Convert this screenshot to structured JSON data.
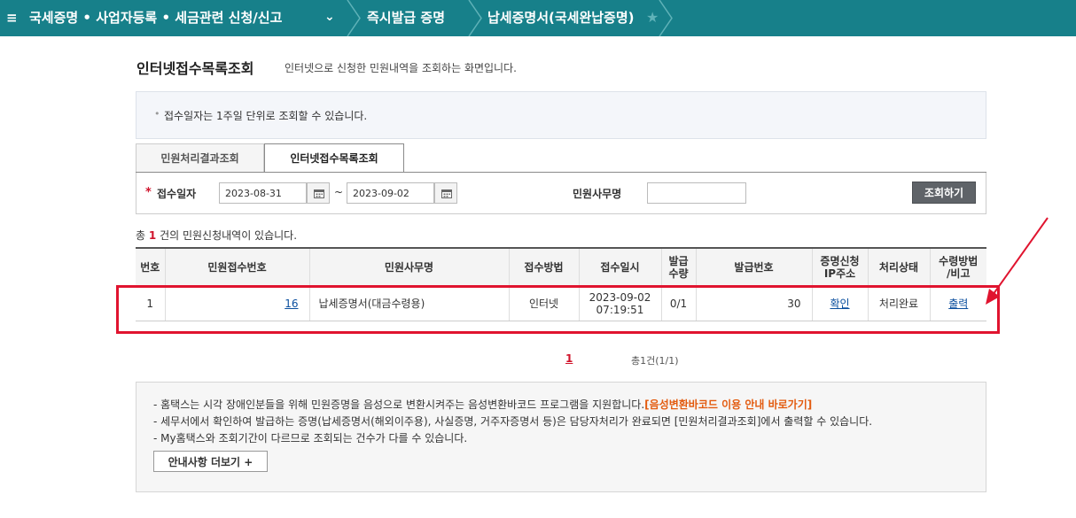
{
  "nav": {
    "menu_icon": "≡",
    "item1": "국세증명 • 사업자등록 • 세금관련 신청/신고",
    "item2": "즉시발급 증명",
    "item3": "납세증명서(국세완납증명)",
    "favorite_icon": "★"
  },
  "page": {
    "title": "인터넷접수목록조회",
    "description": "인터넷으로 신청한 민원내역을 조회하는 화면입니다."
  },
  "info": {
    "bullet": "•",
    "text": "접수일자는 1주일 단위로 조회할 수 있습니다."
  },
  "tabs": [
    {
      "label": "민원처리결과조회",
      "active": false
    },
    {
      "label": "인터넷접수목록조회",
      "active": true
    }
  ],
  "search": {
    "required_mark": "*",
    "date_label": "접수일자",
    "start_date": "2023-08-31",
    "tilde": "~",
    "end_date": "2023-09-02",
    "office_label": "민원사무명",
    "office_value": "",
    "button_label": "조회하기"
  },
  "count": {
    "prefix": "총",
    "number": "1",
    "suffix": "건의 민원신청내역이 있습니다."
  },
  "table": {
    "headers": [
      "번호",
      "민원접수번호",
      "민원사무명",
      "접수방법",
      "접수일시",
      "발급\n수량",
      "발급번호",
      "증명신청\nIP주소",
      "처리상태",
      "수령방법\n/비고"
    ],
    "rows": [
      {
        "no": "1",
        "receipt_no": "16",
        "office": "납세증명서(대금수령용)",
        "method": "인터넷",
        "date": "2023-09-02",
        "time": "07:19:51",
        "quantity": "0/1",
        "issue_no": "30",
        "ip": "확인",
        "status": "처리완료",
        "receive": "출력"
      }
    ]
  },
  "pagination": {
    "current": "1",
    "total": "총1건(1/1)"
  },
  "guide": {
    "line1": "- 홈택스는 시각 장애인분들을 위해 민원증명을 음성으로 변환시켜주는 음성변환바코드 프로그램을 지원합니다.",
    "line1_link": "[음성변환바코드 이용 안내 바로가기]",
    "line2": "- 세무서에서 확인하여 발급하는 증명(납세증명서(해외이주용), 사실증명, 거주자증명서 등)은 담당자처리가 완료되면 [민원처리결과조회]에서 출력할 수 있습니다.",
    "line3": "- My홈택스와 조회기간이 다르므로 조회되는 건수가 다를 수 있습니다.",
    "more_button": "안내사항 더보기 +"
  },
  "colors": {
    "nav_bg": "#17808a",
    "highlight": "#e0142f",
    "accent_red": "#d0142c",
    "link_orange": "#e35b0f"
  }
}
